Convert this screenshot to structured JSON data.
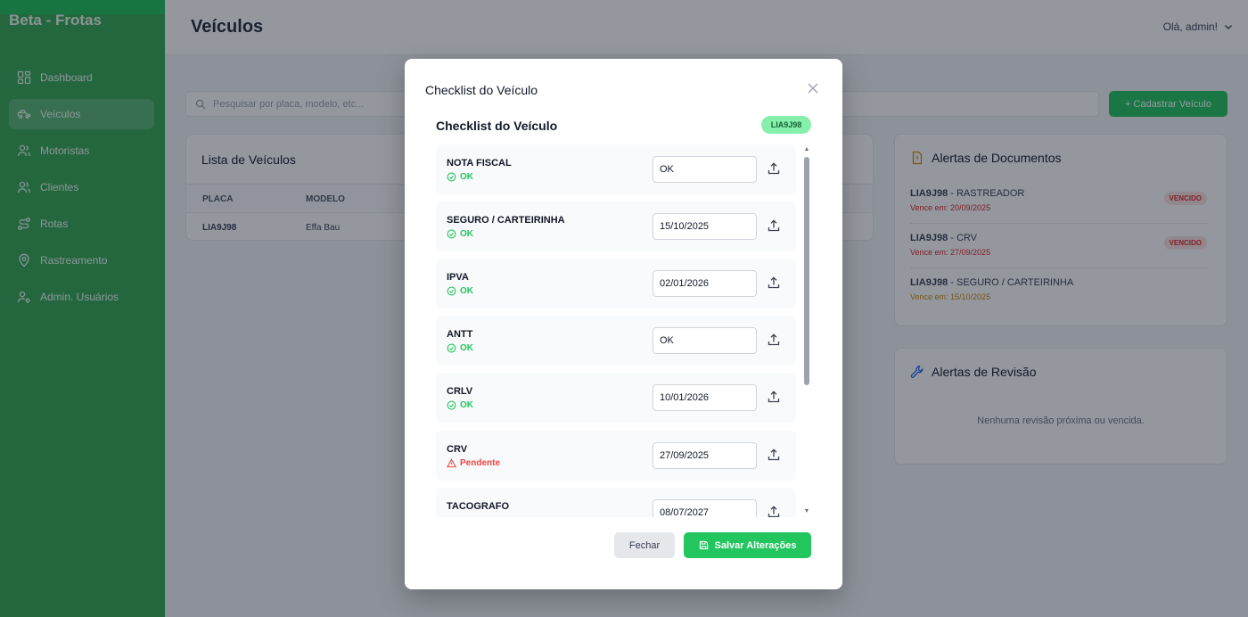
{
  "app": {
    "brand": "Beta - Frotas"
  },
  "sidebar": {
    "items": [
      {
        "label": "Dashboard",
        "icon": "dashboard-icon"
      },
      {
        "label": "Veículos",
        "icon": "truck-icon",
        "active": true
      },
      {
        "label": "Motoristas",
        "icon": "users-icon"
      },
      {
        "label": "Clientes",
        "icon": "users-icon"
      },
      {
        "label": "Rotas",
        "icon": "route-icon"
      },
      {
        "label": "Rastreamento",
        "icon": "map-pin-icon"
      },
      {
        "label": "Admin. Usuários",
        "icon": "user-cog-icon"
      }
    ]
  },
  "header": {
    "title": "Veículos",
    "greeting": "Olá, admin!"
  },
  "search": {
    "placeholder": "Pesquisar por placa, modelo, etc..."
  },
  "add_button": {
    "label": "+ Cadastrar Veículo"
  },
  "vehicle_list": {
    "title": "Lista de Veículos",
    "columns": [
      "PLACA",
      "MODELO"
    ],
    "rows": [
      {
        "plate": "LIA9J98",
        "model": "Effa Bau"
      }
    ]
  },
  "document_alerts": {
    "title": "Alertas de Documentos",
    "items": [
      {
        "plate": "LIA9J98",
        "doc": " - RASTREADOR",
        "due": "Vence em: 20/09/2025",
        "badge": "VENCIDO"
      },
      {
        "plate": "LIA9J98",
        "doc": " - CRV",
        "due": "Vence em: 27/09/2025",
        "badge": "VENCIDO"
      },
      {
        "plate": "LIA9J98",
        "doc": " - SEGURO / CARTEIRINHA",
        "due": "Vence em: 15/10/2025",
        "badge": ""
      }
    ]
  },
  "revision_alerts": {
    "title": "Alertas de Revisão",
    "empty": "Nenhuma revisão próxima ou vencida."
  },
  "modal": {
    "title": "Checklist do Veículo",
    "inner_title": "Checklist do Veículo",
    "plate": "LIA9J98",
    "items": [
      {
        "name": "NOTA FISCAL",
        "status": "OK",
        "value": "OK"
      },
      {
        "name": "SEGURO / CARTEIRINHA",
        "status": "OK",
        "value": "15/10/2025"
      },
      {
        "name": "IPVA",
        "status": "OK",
        "value": "02/01/2026"
      },
      {
        "name": "ANTT",
        "status": "OK",
        "value": "OK"
      },
      {
        "name": "CRLV",
        "status": "OK",
        "value": "10/01/2026"
      },
      {
        "name": "CRV",
        "status": "Pendente",
        "value": "27/09/2025"
      },
      {
        "name": "TACOGRAFO",
        "status": "",
        "value": "08/07/2027"
      }
    ],
    "close_label": "Fechar",
    "save_label": "Salvar Alterações"
  },
  "colors": {
    "sidebar": "#34a853",
    "primary": "#22c55e",
    "danger": "#ef4444",
    "warning": "#ca8a04"
  }
}
